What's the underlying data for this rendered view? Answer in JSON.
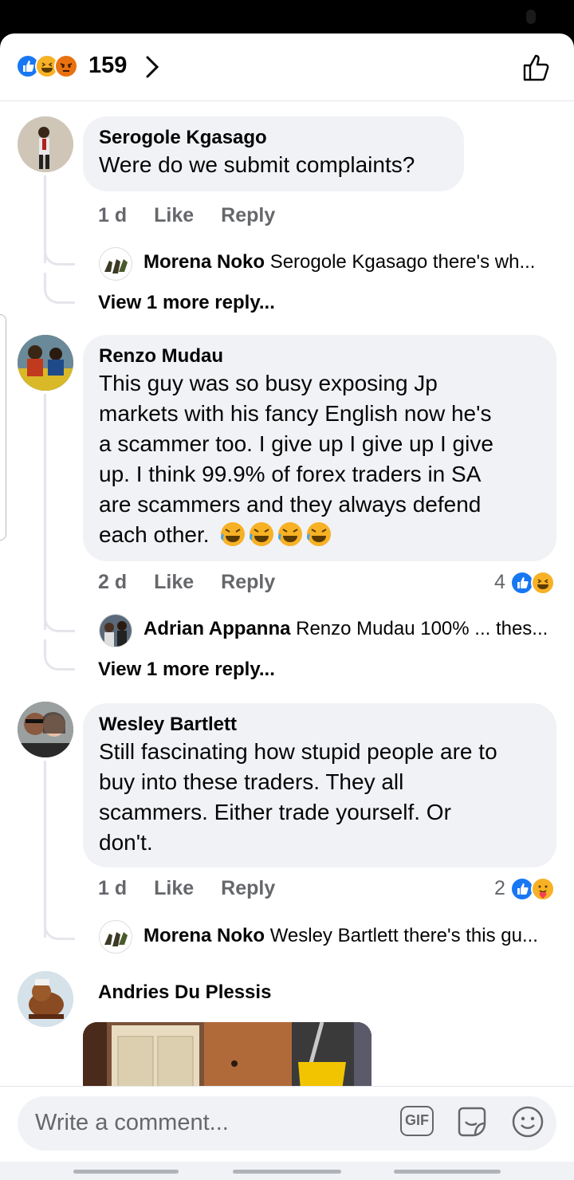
{
  "reactions_bar": {
    "count": "159",
    "icons": [
      "like-icon",
      "haha-icon",
      "angry-icon"
    ]
  },
  "comments": [
    {
      "name": "Serogole Kgasago",
      "text": [
        "Were do we submit complaints?"
      ],
      "time": "1 d",
      "like": "Like",
      "reply": "Reply",
      "reply_preview": {
        "name": "Morena Noko",
        "text": "Serogole Kgasago there's wh..."
      },
      "more_replies": "View 1 more reply..."
    },
    {
      "name": "Renzo Mudau",
      "text": [
        "This guy was so busy exposing Jp",
        "markets with his fancy English now he's",
        "a scammer too. I give up I give up I give",
        "up. I think 99.9% of forex traders in SA",
        "are scammers and they always defend",
        "each other."
      ],
      "emoji_trail": "rolling-on-floor-laughing x4",
      "time": "2 d",
      "like": "Like",
      "reply": "Reply",
      "reaction_count": "4",
      "reaction_icons": [
        "like-icon",
        "haha-icon"
      ],
      "reply_preview": {
        "name": "Adrian Appanna",
        "text": "Renzo Mudau 100% ... thes..."
      },
      "more_replies": "View 1 more reply..."
    },
    {
      "name": "Wesley Bartlett",
      "text": [
        "Still fascinating how stupid people are to",
        "buy into these traders. They all",
        "scammers. Either trade yourself. Or",
        "don't."
      ],
      "time": "1 d",
      "like": "Like",
      "reply": "Reply",
      "reaction_count": "2",
      "reaction_icons": [
        "like-icon",
        "care-icon"
      ],
      "reply_preview": {
        "name": "Morena Noko",
        "text": "Wesley Bartlett there's this gu..."
      }
    },
    {
      "name": "Andries Du Plessis"
    }
  ],
  "composer": {
    "placeholder": "Write a comment...",
    "gif_label": "GIF"
  },
  "colors": {
    "like_blue": "#1877f2",
    "haha_yellow": "#f7b125",
    "angry_red": "#e9710f",
    "bubble_gray": "#f0f2f5",
    "meta_gray": "#65676b"
  }
}
